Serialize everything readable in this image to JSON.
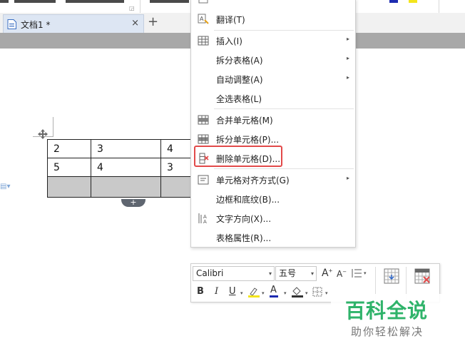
{
  "tab": {
    "title": "文档1 *",
    "close_glyph": "×",
    "add_glyph": "+"
  },
  "table": {
    "rows": [
      [
        "2",
        "3",
        "4"
      ],
      [
        "5",
        "4",
        "3"
      ],
      [
        "",
        "",
        ""
      ]
    ]
  },
  "add_row_glyph": "+",
  "context_menu": {
    "items": [
      {
        "label": "翻译(T)",
        "icon": "translate-icon",
        "submenu": false
      },
      {
        "label": "插入(I)",
        "icon": "table-insert-icon",
        "submenu": true
      },
      {
        "label": "拆分表格(A)",
        "icon": "",
        "submenu": true
      },
      {
        "label": "自动调整(A)",
        "icon": "",
        "submenu": true
      },
      {
        "label": "全选表格(L)",
        "icon": "",
        "submenu": false
      },
      {
        "label": "合并单元格(M)",
        "icon": "merge-cells-icon",
        "submenu": false
      },
      {
        "label": "拆分单元格(P)...",
        "icon": "split-cells-icon",
        "submenu": false
      },
      {
        "label": "删除单元格(D)...",
        "icon": "delete-cells-icon",
        "submenu": false,
        "highlighted": true
      },
      {
        "label": "单元格对齐方式(G)",
        "icon": "cell-align-icon",
        "submenu": true
      },
      {
        "label": "边框和底纹(B)...",
        "icon": "",
        "submenu": false
      },
      {
        "label": "文字方向(X)...",
        "icon": "text-direction-icon",
        "submenu": false
      },
      {
        "label": "表格属性(R)...",
        "icon": "",
        "submenu": false
      }
    ],
    "arrow_glyph": "▸",
    "highlight_color": "#e24a4a"
  },
  "mini_toolbar": {
    "font": "Calibri",
    "size": "五号",
    "grow_font": "A",
    "shrink_font": "A",
    "bold": "B",
    "italic": "I",
    "underline": "U",
    "font_color": "A",
    "dropdown_glyph": "▾"
  },
  "watermark": {
    "title": "百科全说",
    "subtitle": "助你轻松解决"
  },
  "colors": {
    "accent_green": "#2fb36a",
    "highlight_yellow": "#f3e51c",
    "font_color_blue": "#1d2bb0"
  }
}
